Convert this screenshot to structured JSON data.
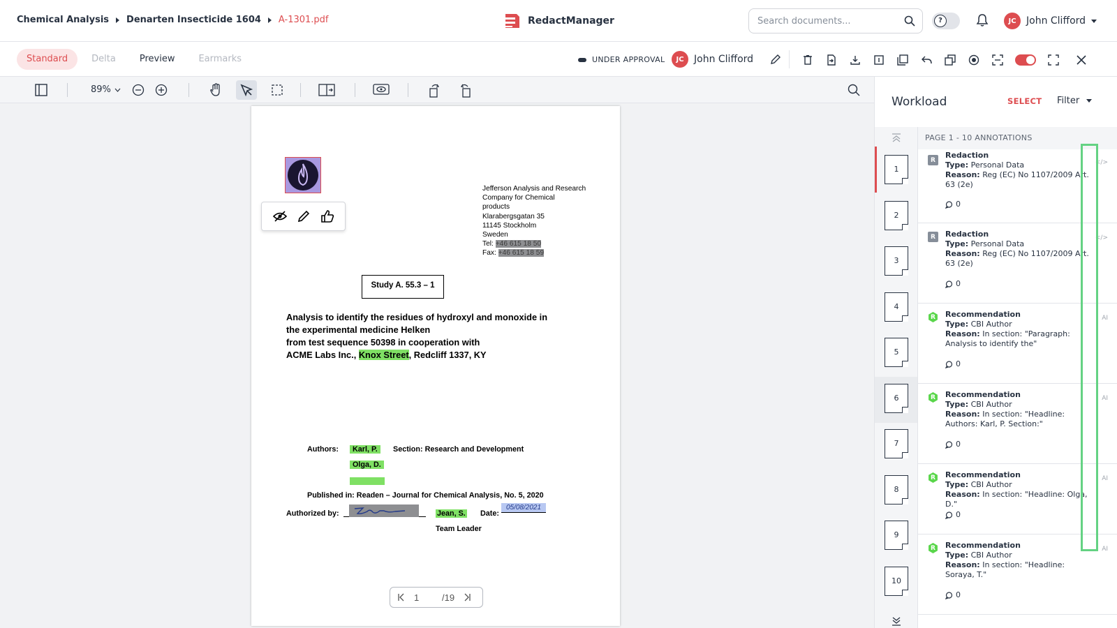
{
  "breadcrumbs": [
    "Chemical Analysis",
    "Denarten Insecticide 1604",
    "A-1301.pdf"
  ],
  "app": {
    "name": "RedactManager"
  },
  "search": {
    "placeholder": "Search documents..."
  },
  "user": {
    "name": "John Clifford",
    "initials": "JC"
  },
  "view_modes": [
    {
      "label": "Standard",
      "state": "active"
    },
    {
      "label": "Delta",
      "state": "disabled"
    },
    {
      "label": "Preview",
      "state": "normal"
    },
    {
      "label": "Earmarks",
      "state": "disabled"
    }
  ],
  "status": "UNDER APPROVAL",
  "toolbar": {
    "zoom": "89%"
  },
  "document": {
    "address": [
      "Jefferson Analysis and Research",
      "Company for Chemical",
      "products",
      "Klarabergsgatan 35",
      "11145 Stockholm",
      "Sweden"
    ],
    "tel_label": "Tel:",
    "tel": "+46 615 18 50",
    "fax_label": "Fax:",
    "fax": "+46 615 18 59",
    "study": "Study A. 55.3 – 1",
    "analysis_lines": [
      "Analysis to identify the residues of hydroxyl and monoxide in",
      "the experimental medicine Helken",
      "from test sequence 50398 in cooperation with"
    ],
    "acme_prefix": "ACME Labs Inc., ",
    "acme_street": "Knox Street",
    "acme_suffix": ", Redcliff 1337, KY",
    "authors_label": "Authors:",
    "author1": "Karl, P.",
    "author2": "Olga, D.",
    "section": "Section: Research and Development",
    "published": "Published in: Readen – Journal for Chemical Analysis, No. 5, 2020",
    "authorized_label": "Authorized by:",
    "authorizer": "Jean, S.",
    "date_label": "Date:",
    "date_value": "05/08/2021",
    "role": "Team Leader"
  },
  "pager": {
    "current": "1",
    "total": "/19"
  },
  "workload": {
    "title": "Workload",
    "select": "SELECT",
    "filter": "Filter",
    "page_header": "PAGE 1 - 10 ANNOTATIONS",
    "thumbs": [
      "1",
      "2",
      "3",
      "4",
      "5",
      "6",
      "7",
      "8",
      "9",
      "10"
    ],
    "annotations": [
      {
        "badge": "R",
        "kind": "redact",
        "title": "Redaction",
        "type_label": "Type:",
        "type": "Personal Data",
        "reason_label": "Reason:",
        "reason": "Reg (EC) No 1107/2009 Art. 63 (2e)",
        "comments": "0",
        "tag": "</>"
      },
      {
        "badge": "R",
        "kind": "redact",
        "title": "Redaction",
        "type_label": "Type:",
        "type": "Personal Data",
        "reason_label": "Reason:",
        "reason": "Reg (EC) No 1107/2009 Art. 63 (2e)",
        "comments": "0",
        "tag": "</>"
      },
      {
        "badge": "R",
        "kind": "rec",
        "title": "Recommendation",
        "type_label": "Type:",
        "type": "CBI Author",
        "reason_label": "Reason:",
        "reason": "In section: \"Paragraph: Analysis to identify the\"",
        "comments": "0",
        "tag": "AI"
      },
      {
        "badge": "R",
        "kind": "rec",
        "title": "Recommendation",
        "type_label": "Type:",
        "type": "CBI Author",
        "reason_label": "Reason:",
        "reason": "In section: \"Headline: Authors: Karl, P. Section:\"",
        "comments": "0",
        "tag": "AI"
      },
      {
        "badge": "R",
        "kind": "rec",
        "title": "Recommendation",
        "type_label": "Type:",
        "type": "CBI Author",
        "reason_label": "Reason:",
        "reason": "In section: \"Headline: Olga, D.\"",
        "comments": "0",
        "tag": "AI"
      },
      {
        "badge": "R",
        "kind": "rec",
        "title": "Recommendation",
        "type_label": "Type:",
        "type": "CBI Author",
        "reason_label": "Reason:",
        "reason": "In section: \"Headline: Soraya, T.\"",
        "comments": "0",
        "tag": "AI"
      }
    ]
  },
  "colors": {
    "accent": "#dd4d50",
    "highlight_green": "#7fe064",
    "redaction_gray": "#8e8f92",
    "focus_frame": "#64d283"
  }
}
